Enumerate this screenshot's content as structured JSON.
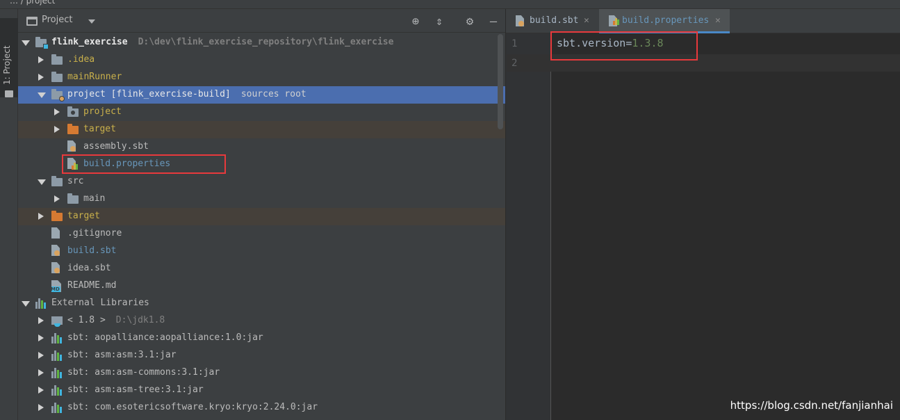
{
  "breadcrumb": "… / project",
  "sidebar": {
    "tab_label": "1: Project"
  },
  "panel": {
    "title": "Project"
  },
  "tree": [
    {
      "label": "flink_exercise",
      "meta": "D:\\dev\\flink_exercise_repository\\flink_exercise",
      "depth": 0,
      "state": "down",
      "icon": "module-folder",
      "color": "white",
      "bold": true
    },
    {
      "label": ".idea",
      "meta": "",
      "depth": 1,
      "state": "right",
      "icon": "folder",
      "color": "yellow"
    },
    {
      "label": "mainRunner",
      "meta": "",
      "depth": 1,
      "state": "right",
      "icon": "folder",
      "color": "yellow"
    },
    {
      "label": "project [flink_exercise-build]",
      "meta": "sources root",
      "depth": 1,
      "state": "down",
      "icon": "module-folder-sbt",
      "color": "white",
      "selected": true
    },
    {
      "label": "project",
      "meta": "",
      "depth": 2,
      "state": "right",
      "icon": "package-folder",
      "color": "yellow"
    },
    {
      "label": "target",
      "meta": "",
      "depth": 2,
      "state": "right",
      "icon": "orange-folder",
      "color": "orange",
      "excluded": true
    },
    {
      "label": "assembly.sbt",
      "meta": "",
      "depth": 2,
      "state": "none",
      "icon": "sbt-file",
      "color": "default"
    },
    {
      "label": "build.properties",
      "meta": "",
      "depth": 2,
      "state": "none",
      "icon": "properties-file",
      "color": "blue"
    },
    {
      "label": "src",
      "meta": "",
      "depth": 1,
      "state": "down",
      "icon": "folder",
      "color": "default"
    },
    {
      "label": "main",
      "meta": "",
      "depth": 2,
      "state": "right",
      "icon": "folder",
      "color": "default"
    },
    {
      "label": "target",
      "meta": "",
      "depth": 1,
      "state": "right",
      "icon": "orange-folder",
      "color": "orange",
      "excluded": true
    },
    {
      "label": ".gitignore",
      "meta": "",
      "depth": 1,
      "state": "none",
      "icon": "ignore-file",
      "color": "default"
    },
    {
      "label": "build.sbt",
      "meta": "",
      "depth": 1,
      "state": "none",
      "icon": "sbt-file",
      "color": "blue"
    },
    {
      "label": "idea.sbt",
      "meta": "",
      "depth": 1,
      "state": "none",
      "icon": "sbt-file",
      "color": "default"
    },
    {
      "label": "README.md",
      "meta": "",
      "depth": 1,
      "state": "none",
      "icon": "markdown-file",
      "color": "default"
    },
    {
      "label": "External Libraries",
      "meta": "",
      "depth": 0,
      "state": "down",
      "icon": "library",
      "color": "default"
    },
    {
      "label": "< 1.8 >",
      "meta": "D:\\jdk1.8",
      "depth": 1,
      "state": "right",
      "icon": "jdk",
      "color": "default"
    },
    {
      "label": "sbt: aopalliance:aopalliance:1.0:jar",
      "meta": "",
      "depth": 1,
      "state": "right",
      "icon": "library",
      "color": "default"
    },
    {
      "label": "sbt: asm:asm:3.1:jar",
      "meta": "",
      "depth": 1,
      "state": "right",
      "icon": "library",
      "color": "default"
    },
    {
      "label": "sbt: asm:asm-commons:3.1:jar",
      "meta": "",
      "depth": 1,
      "state": "right",
      "icon": "library",
      "color": "default"
    },
    {
      "label": "sbt: asm:asm-tree:3.1:jar",
      "meta": "",
      "depth": 1,
      "state": "right",
      "icon": "library",
      "color": "default"
    },
    {
      "label": "sbt: com.esotericsoftware.kryo:kryo:2.24.0:jar",
      "meta": "",
      "depth": 1,
      "state": "right",
      "icon": "library",
      "color": "default"
    }
  ],
  "editor": {
    "tabs": [
      {
        "label": "build.sbt",
        "close": "✕",
        "active": false
      },
      {
        "label": "build.properties",
        "close": "✕",
        "active": true
      }
    ],
    "line_numbers": [
      "1",
      "2"
    ],
    "code": {
      "key": "sbt.version",
      "eq": "=",
      "value": "1.3.8"
    }
  },
  "watermark": "https://blog.csdn.net/fanjianhai",
  "colors": {
    "selection": "#4b6eaf",
    "excluded": "#45403a",
    "highlight": "#e8393c",
    "accent": "#4a88c7"
  }
}
